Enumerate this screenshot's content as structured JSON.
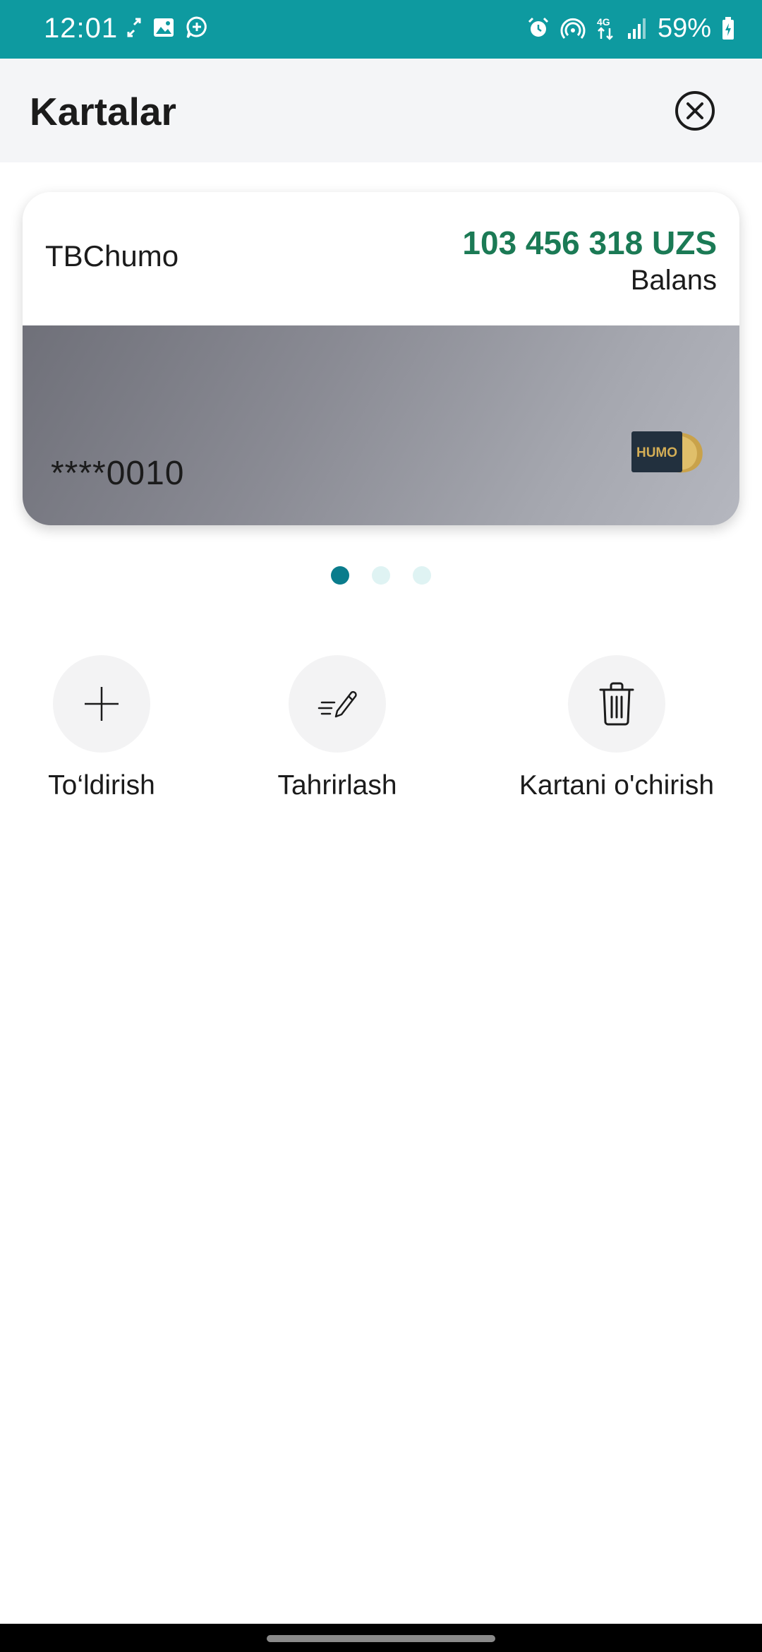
{
  "status_bar": {
    "time": "12:01",
    "left_icons": [
      "transfer-icon",
      "image-icon",
      "message-icon"
    ],
    "right_icons": [
      "alarm-icon",
      "hotspot-icon",
      "4g-icon",
      "signal-icon"
    ],
    "battery_text": "59%",
    "background_color": "#0e9aa0"
  },
  "header": {
    "title": "Kartalar",
    "close_icon": "close-icon"
  },
  "card": {
    "name": "TBChumo",
    "balance": "103 456 318 UZS",
    "balance_label": "Balans",
    "number_masked": "****0010",
    "brand_logo_text": "HUMO",
    "balance_color": "#1b7a55"
  },
  "pagination": {
    "count": 3,
    "active_index": 0,
    "active_color": "#0a7c8c",
    "inactive_color": "#dff3f3"
  },
  "actions": [
    {
      "label": "To‘ldirish",
      "icon": "plus-icon"
    },
    {
      "label": "Tahrirlash",
      "icon": "edit-icon"
    },
    {
      "label": "Kartani o'chirish",
      "icon": "trash-icon"
    }
  ]
}
